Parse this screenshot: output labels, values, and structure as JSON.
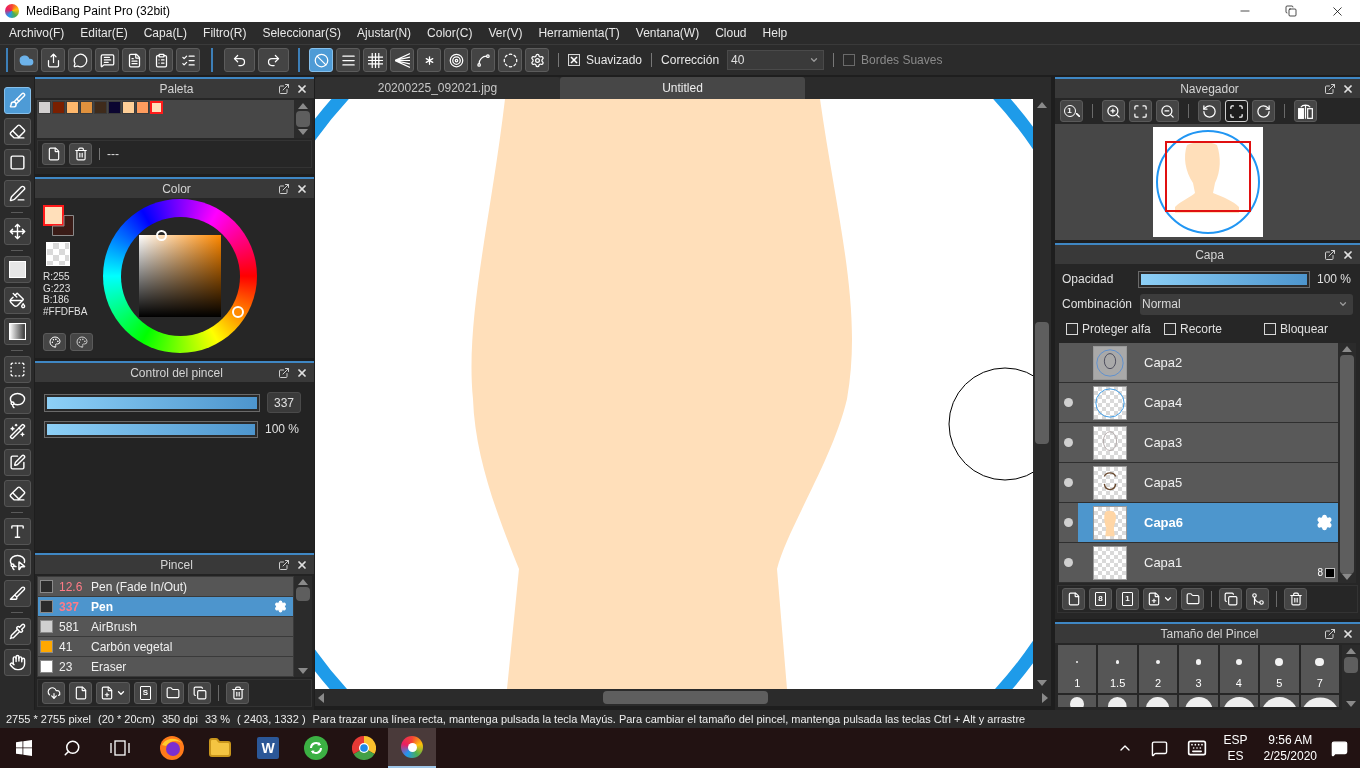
{
  "window": {
    "title": "MediBang Paint Pro (32bit)"
  },
  "menu": [
    "Archivo(F)",
    "Editar(E)",
    "Capa(L)",
    "Filtro(R)",
    "Seleccionar(S)",
    "Ajustar(N)",
    "Color(C)",
    "Ver(V)",
    "Herramienta(T)",
    "Ventana(W)",
    "Cloud",
    "Help"
  ],
  "toolbar": {
    "actions": [
      {
        "kind": "cloud"
      },
      {
        "kind": "share"
      },
      {
        "kind": "speech"
      },
      {
        "kind": "comment"
      },
      {
        "kind": "page"
      },
      {
        "kind": "list"
      },
      {
        "kind": "checklist"
      }
    ],
    "history": [
      {
        "kind": "undo"
      },
      {
        "kind": "redo"
      }
    ],
    "rulers": [
      {
        "kind": "none",
        "selected": true
      },
      {
        "kind": "parallel",
        "selected": false
      },
      {
        "kind": "grid",
        "selected": false
      },
      {
        "kind": "perspective",
        "selected": false
      },
      {
        "kind": "radial",
        "selected": false
      },
      {
        "kind": "concentric",
        "selected": false
      },
      {
        "kind": "curve",
        "selected": false
      },
      {
        "kind": "ellipse",
        "selected": false
      },
      {
        "kind": "settings",
        "selected": false
      }
    ],
    "smoothing": {
      "label": "Suavizado",
      "checked": true
    },
    "correction": {
      "label": "Corrección",
      "value": "40"
    },
    "soft_edges": {
      "label": "Bordes Suaves",
      "checked": false,
      "disabled": true
    }
  },
  "tools": [
    {
      "items": [
        {
          "kind": "brush",
          "selected": true
        },
        {
          "kind": "eraser",
          "selected": false
        },
        {
          "kind": "dot",
          "selected": false
        },
        {
          "kind": "shape",
          "selected": false
        }
      ]
    },
    {
      "items": [
        {
          "kind": "move",
          "selected": false
        }
      ]
    },
    {
      "items": [
        {
          "kind": "fill",
          "selected": false
        },
        {
          "kind": "bucket",
          "selected": false
        },
        {
          "kind": "gradient",
          "selected": false
        }
      ]
    },
    {
      "items": [
        {
          "kind": "select",
          "selected": false
        },
        {
          "kind": "lasso",
          "selected": false
        },
        {
          "kind": "wand",
          "selected": false
        },
        {
          "kind": "select-pen",
          "selected": false
        },
        {
          "kind": "select-eraser",
          "selected": false
        }
      ]
    },
    {
      "items": [
        {
          "kind": "text",
          "selected": false
        },
        {
          "kind": "operation",
          "selected": false
        },
        {
          "kind": "divide",
          "selected": false
        }
      ]
    },
    {
      "items": [
        {
          "kind": "eyedropper",
          "selected": false
        },
        {
          "kind": "hand",
          "selected": false
        }
      ]
    }
  ],
  "palette": {
    "title": "Paleta",
    "swatches": [
      {
        "color": "#d3d0d0",
        "selected": false
      },
      {
        "color": "#7a1f00",
        "selected": false
      },
      {
        "color": "#ffb86c",
        "selected": false
      },
      {
        "color": "#e0913d",
        "selected": false
      },
      {
        "color": "#3f2b1b",
        "selected": false
      },
      {
        "color": "#0b0530",
        "selected": false
      },
      {
        "color": "#ffcf97",
        "selected": false
      },
      {
        "color": "#ff9c5e",
        "selected": false
      },
      {
        "color": "#ffdfba",
        "selected": true
      }
    ],
    "action_groups": [
      {
        "items": [
          {
            "kind": "new"
          },
          {
            "kind": "delete"
          }
        ]
      }
    ],
    "name": "---"
  },
  "color": {
    "title": "Color",
    "swatches": [
      {
        "kind": "foreground",
        "color": "#ffdfba",
        "selected": true
      },
      {
        "kind": "background",
        "color": "#3a1c17",
        "selected": false
      }
    ],
    "readout": [
      "R:255",
      "G:223",
      "B:186",
      "#FFDFBA"
    ],
    "actions": [
      {
        "kind": "palette"
      },
      {
        "kind": "palette-settings"
      }
    ]
  },
  "brush_control": {
    "title": "Control del pincel",
    "size": {
      "level": 1,
      "value": "337"
    },
    "opacity": {
      "level": 1,
      "reading": "100 %"
    }
  },
  "brushes": {
    "title": "Pincel",
    "items": [
      {
        "color": "#2b2b2b",
        "size": "12.6",
        "name": "Pen (Fade In/Out)",
        "size_alert": true,
        "selected": false
      },
      {
        "color": "#2b2b2b",
        "size": "337",
        "name": "Pen",
        "size_alert": true,
        "selected": true
      },
      {
        "color": "#d0d0d0",
        "size": "581",
        "name": "AirBrush",
        "size_alert": false,
        "selected": false
      },
      {
        "color": "#ffa800",
        "size": "41",
        "name": "Carbón vegetal",
        "size_alert": false,
        "selected": false
      },
      {
        "color": "#ffffff",
        "size": "23",
        "name": "Eraser",
        "size_alert": false,
        "selected": false
      }
    ],
    "action_groups": [
      {
        "items": [
          {
            "kind": "download"
          },
          {
            "kind": "new"
          },
          {
            "kind": "add-menu"
          },
          {
            "kind": "script",
            "label": "S"
          },
          {
            "kind": "folder"
          },
          {
            "kind": "duplicate"
          }
        ]
      },
      {
        "items": [
          {
            "kind": "delete"
          }
        ]
      }
    ]
  },
  "canvas": {
    "tabs": [
      {
        "label": "20200225_092021.jpg",
        "selected": false
      },
      {
        "label": "Untitled",
        "selected": true
      }
    ]
  },
  "navigator": {
    "title": "Navegador",
    "tool_groups": [
      {
        "items": [
          {
            "kind": "actual-size",
            "label": "1",
            "selected": false
          }
        ]
      },
      {
        "items": [
          {
            "kind": "zoom-in",
            "selected": false
          },
          {
            "kind": "fit",
            "selected": false
          },
          {
            "kind": "zoom-out",
            "selected": false
          }
        ]
      },
      {
        "items": [
          {
            "kind": "rotate-left",
            "selected": false
          },
          {
            "kind": "fit-window",
            "selected": true
          },
          {
            "kind": "rotate-right",
            "selected": false
          }
        ]
      },
      {
        "items": [
          {
            "kind": "flip",
            "selected": false
          }
        ]
      }
    ]
  },
  "layers": {
    "title": "Capa",
    "opacity": {
      "label": "Opacidad",
      "level": 1,
      "reading": "100 %"
    },
    "blend": {
      "label": "Combinación",
      "value": "Normal"
    },
    "options": [
      {
        "label": "Proteger alfa",
        "checked": false
      },
      {
        "label": "Recorte",
        "checked": false
      },
      {
        "label": "Bloquear",
        "checked": false
      }
    ],
    "items": [
      {
        "kind": "sketch",
        "name": "Capa2",
        "visible": false,
        "selected": false
      },
      {
        "kind": "ring",
        "name": "Capa4",
        "visible": true,
        "selected": false
      },
      {
        "kind": "faint",
        "name": "Capa3",
        "visible": true,
        "selected": false
      },
      {
        "kind": "outline",
        "name": "Capa5",
        "visible": true,
        "selected": false
      },
      {
        "kind": "fill",
        "name": "Capa6",
        "visible": true,
        "selected": true
      },
      {
        "kind": "empty",
        "name": "Capa1",
        "visible": true,
        "selected": false,
        "bit_depth": "8"
      }
    ],
    "action_groups": [
      {
        "items": [
          {
            "kind": "new"
          },
          {
            "kind": "bit-layer",
            "label": "8"
          },
          {
            "kind": "bit-layer",
            "label": "1"
          },
          {
            "kind": "add-menu"
          },
          {
            "kind": "folder"
          }
        ]
      },
      {
        "items": [
          {
            "kind": "duplicate"
          },
          {
            "kind": "merge"
          }
        ]
      },
      {
        "items": [
          {
            "kind": "delete"
          }
        ]
      }
    ]
  },
  "brush_sizes": {
    "title": "Tamaño del Pincel",
    "items": [
      {
        "label": "1"
      },
      {
        "label": "1.5"
      },
      {
        "label": "2"
      },
      {
        "label": "3"
      },
      {
        "label": "4"
      },
      {
        "label": "5"
      },
      {
        "label": "7"
      }
    ]
  },
  "status_bar": [
    "2755 * 2755 pixel",
    "(20 * 20cm)",
    "350 dpi",
    "33 %",
    "( 2403, 1332 )",
    "Para trazar una línea recta, mantenga pulsada la tecla Mayús. Para cambiar el tamaño del pincel, mantenga pulsada las teclas Ctrl + Alt y arrastre"
  ],
  "taskbar": {
    "apps": [
      {
        "kind": "browser",
        "selected": false
      },
      {
        "kind": "files",
        "selected": false
      },
      {
        "kind": "letter-tile",
        "label": "W",
        "selected": false
      },
      {
        "kind": "sync",
        "selected": false
      },
      {
        "kind": "segmented",
        "selected": false
      },
      {
        "kind": "paint",
        "selected": true
      }
    ],
    "language": [
      "ESP",
      "ES"
    ],
    "time": "9:56 AM",
    "date": "2/25/2020"
  }
}
